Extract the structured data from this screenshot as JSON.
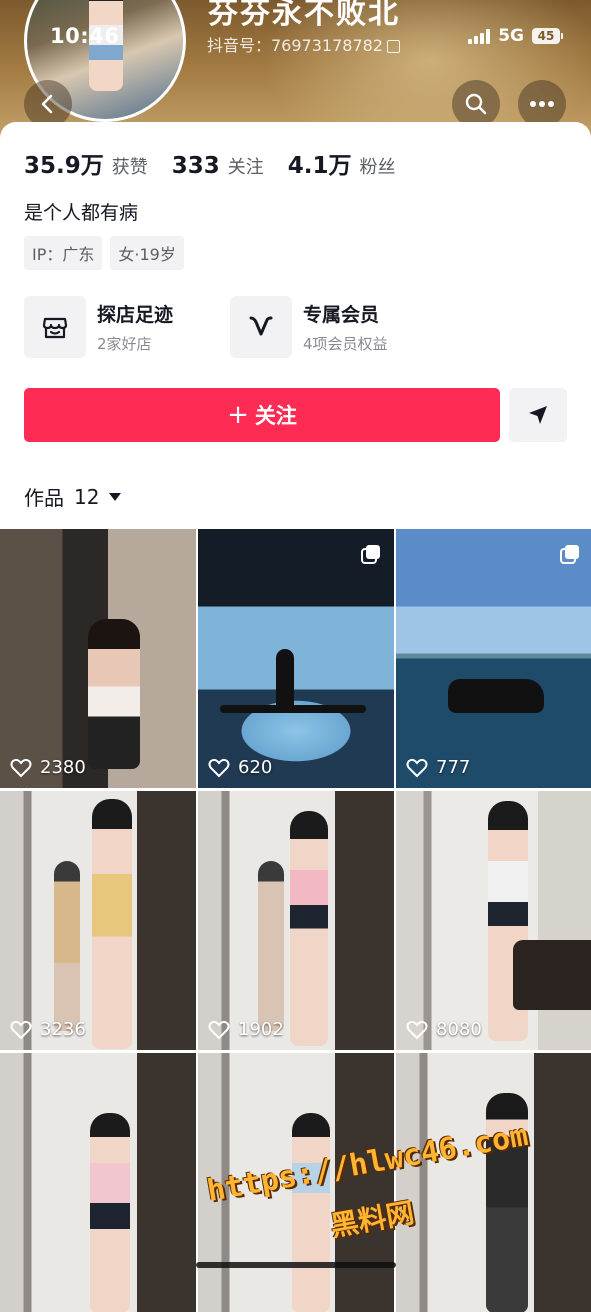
{
  "status_bar": {
    "time": "10:46",
    "network": "5G",
    "battery": "45"
  },
  "profile": {
    "nickname": "芬芬永不败北",
    "douyin_id": "抖音号：76973178782",
    "stats": [
      {
        "value": "35.9万",
        "label": "获赞"
      },
      {
        "value": "333",
        "label": "关注"
      },
      {
        "value": "4.1万",
        "label": "粉丝"
      }
    ],
    "bio": "是个人都有病",
    "tags": [
      "IP：广东",
      "女·19岁"
    ]
  },
  "features": [
    {
      "title": "探店足迹",
      "subtitle": "2家好店",
      "icon": "shop-icon"
    },
    {
      "title": "专属会员",
      "subtitle": "4项会员权益",
      "icon": "vip-icon"
    }
  ],
  "actions": {
    "follow_label": "关注",
    "follow_prefix": "+"
  },
  "works": {
    "label": "作品",
    "count": "12"
  },
  "videos": [
    {
      "likes": "2380",
      "multi": false
    },
    {
      "likes": "620",
      "multi": true
    },
    {
      "likes": "777",
      "multi": true
    },
    {
      "likes": "3236",
      "multi": false
    },
    {
      "likes": "1902",
      "multi": false
    },
    {
      "likes": "8080",
      "multi": false
    },
    {
      "likes": "",
      "multi": false
    },
    {
      "likes": "",
      "multi": false
    },
    {
      "likes": "",
      "multi": false
    }
  ],
  "watermark": {
    "url": "https://hlwc46.com",
    "name": "黑料网"
  },
  "colors": {
    "accent": "#fe2c55",
    "text": "#161823",
    "muted": "#5c5e66"
  }
}
